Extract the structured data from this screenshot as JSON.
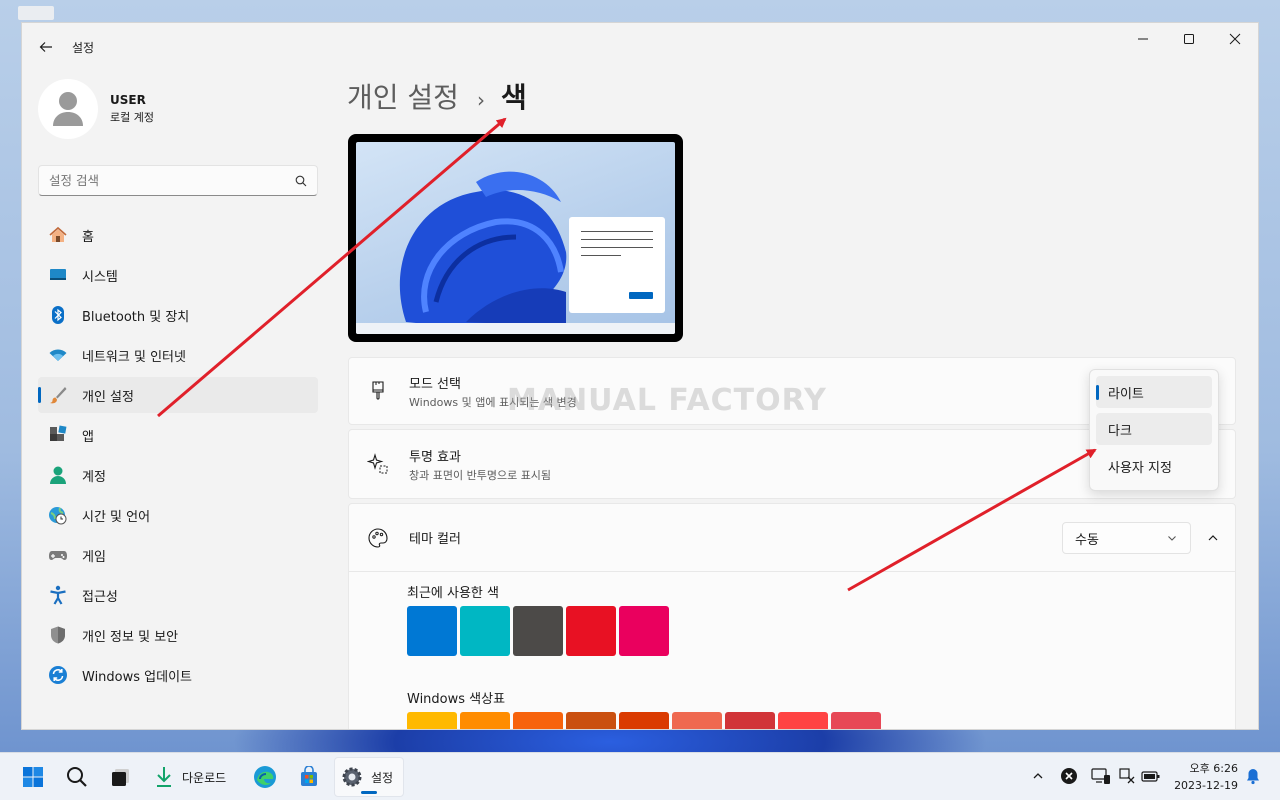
{
  "window": {
    "app_title": "설정"
  },
  "profile": {
    "name": "USER",
    "account_type": "로컬 계정"
  },
  "search": {
    "placeholder": "설정 검색"
  },
  "sidebar": {
    "items": [
      {
        "label": "홈",
        "icon": "home-icon"
      },
      {
        "label": "시스템",
        "icon": "system-icon"
      },
      {
        "label": "Bluetooth 및 장치",
        "icon": "bluetooth-icon"
      },
      {
        "label": "네트워크 및 인터넷",
        "icon": "wifi-icon"
      },
      {
        "label": "개인 설정",
        "icon": "brush-icon",
        "active": true
      },
      {
        "label": "앱",
        "icon": "apps-icon"
      },
      {
        "label": "계정",
        "icon": "account-icon"
      },
      {
        "label": "시간 및 언어",
        "icon": "globe-clock-icon"
      },
      {
        "label": "게임",
        "icon": "gamepad-icon"
      },
      {
        "label": "접근성",
        "icon": "accessibility-icon"
      },
      {
        "label": "개인 정보 및 보안",
        "icon": "shield-icon"
      },
      {
        "label": "Windows 업데이트",
        "icon": "update-icon"
      }
    ]
  },
  "breadcrumb": {
    "parent": "개인 설정",
    "separator": "›",
    "current": "색"
  },
  "mode_card": {
    "title": "모드 선택",
    "description": "Windows 및 앱에 표시되는 색 변경",
    "options": [
      "라이트",
      "다크",
      "사용자 지정"
    ],
    "selected": "라이트"
  },
  "transparency_card": {
    "title": "투명 효과",
    "description": "창과 표면이 반투명으로 표시됨"
  },
  "accent_card": {
    "title": "테마 컬러",
    "mode_value": "수동",
    "recent_label": "최근에 사용한 색",
    "recent_colors": [
      "#0078d4",
      "#00b7c3",
      "#4c4a48",
      "#e81123",
      "#ea005e"
    ],
    "palette_label": "Windows 색상표",
    "palette_colors": [
      "#ffb900",
      "#ff8c00",
      "#f7630c",
      "#ca5010",
      "#da3b01",
      "#ef6950",
      "#d13438",
      "#ff4343",
      "#e74856"
    ]
  },
  "watermark": "MANUAL FACTORY",
  "taskbar": {
    "download_label": "다운로드",
    "settings_label": "설정",
    "time": "오후 6:26",
    "date": "2023-12-19"
  },
  "colors": {
    "accent": "#0067c0",
    "annotation_arrow": "#e0202a"
  }
}
